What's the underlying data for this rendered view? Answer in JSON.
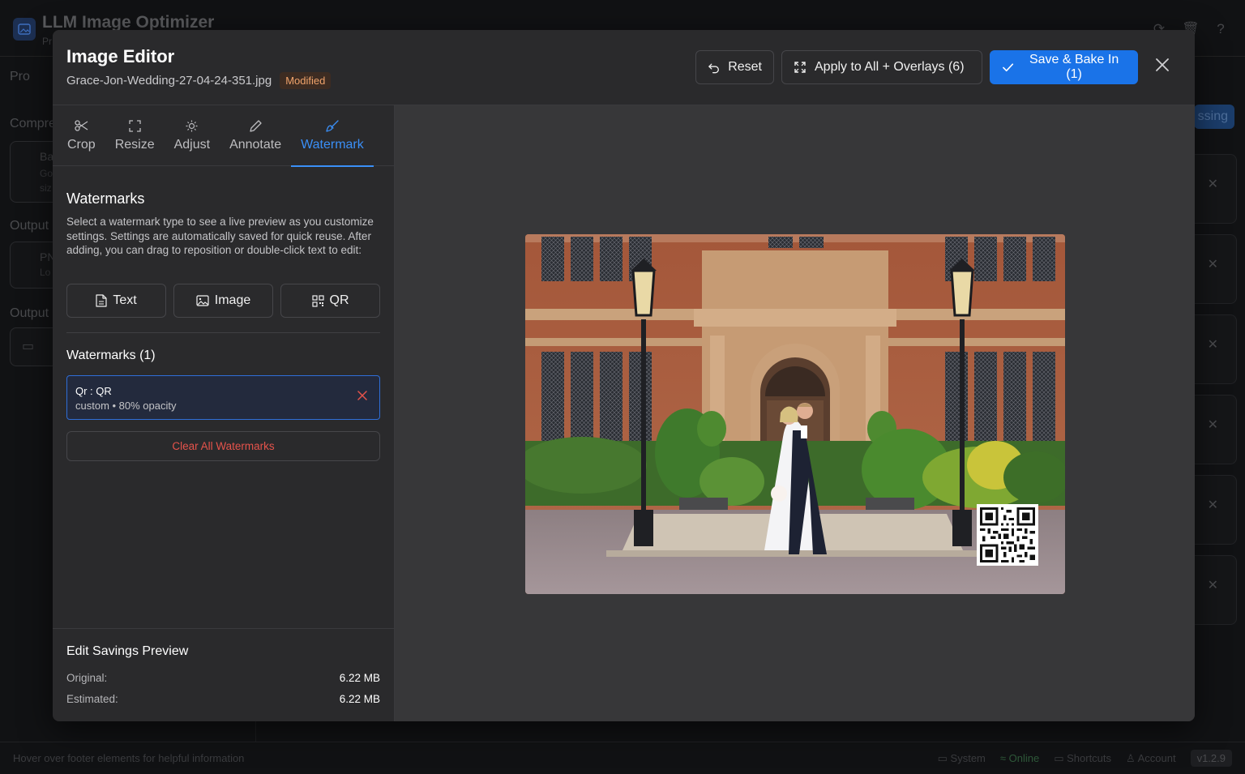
{
  "background": {
    "app_title": "LLM Image Optimizer",
    "app_subtitle": "Pr",
    "side_labels": [
      "Pro",
      "Compre",
      "Output",
      "Output"
    ],
    "box_labels": [
      "Ba",
      "Go",
      "siz",
      "PN",
      "Lo"
    ],
    "processing_label": "ssing",
    "footer_hint": "Hover over footer elements for helpful information",
    "footer_system": "System",
    "footer_online": "Online",
    "footer_shortcuts": "Shortcuts",
    "footer_account": "Account",
    "footer_version": "v1.2.9"
  },
  "modal": {
    "title": "Image Editor",
    "filename": "Grace-Jon-Wedding-27-04-24-351.jpg",
    "status_badge": "Modified",
    "reset_label": "Reset",
    "apply_label": "Apply to All + Overlays (6)",
    "save_label": "Save & Bake In (1)"
  },
  "tabs": [
    {
      "label": "Crop",
      "icon": "scissors-icon"
    },
    {
      "label": "Resize",
      "icon": "resize-icon"
    },
    {
      "label": "Adjust",
      "icon": "sun-icon"
    },
    {
      "label": "Annotate",
      "icon": "pencil-icon"
    },
    {
      "label": "Watermark",
      "icon": "brush-icon",
      "active": true
    }
  ],
  "watermarks": {
    "heading": "Watermarks",
    "description": "Select a watermark type to see a live preview as you customize settings. Settings are automatically saved for quick reuse. After adding, you can drag to reposition or double-click text to edit:",
    "types": [
      {
        "label": "Text",
        "icon": "file-text-icon"
      },
      {
        "label": "Image",
        "icon": "image-icon"
      },
      {
        "label": "QR",
        "icon": "qr-code-icon"
      }
    ],
    "list_heading": "Watermarks (1)",
    "items": [
      {
        "title": "Qr : QR",
        "subtitle": "custom • 80% opacity"
      }
    ],
    "clear_label": "Clear All Watermarks"
  },
  "savings": {
    "title": "Edit Savings Preview",
    "original_label": "Original:",
    "original_value": "6.22 MB",
    "estimated_label": "Estimated:",
    "estimated_value": "6.22 MB"
  },
  "colors": {
    "accent": "#1a73e8",
    "active_tab": "#3a8ff7",
    "danger": "#e5534b",
    "modified_badge": "#f0a36b"
  }
}
